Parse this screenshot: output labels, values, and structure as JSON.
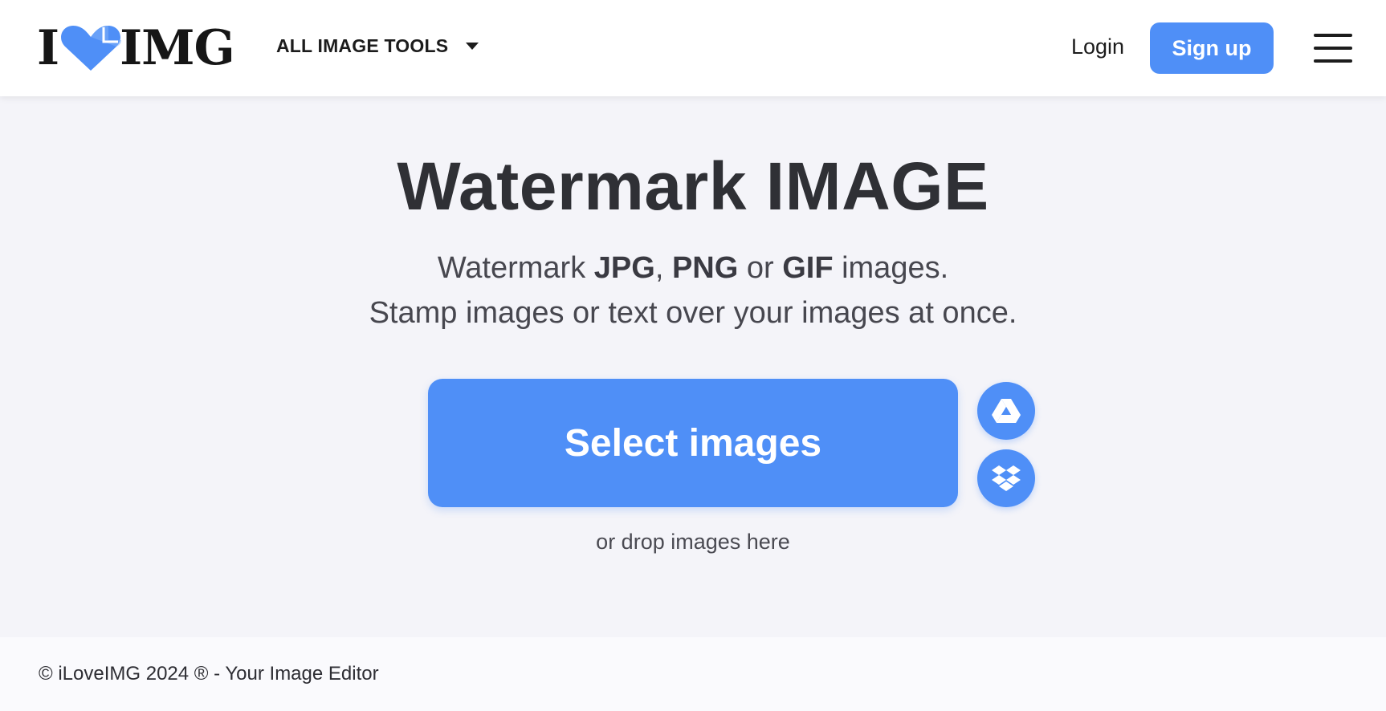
{
  "header": {
    "logo": {
      "text_left": "I",
      "text_right": "IMG",
      "icon": "heart-icon",
      "brand_color": "#4f8ff7"
    },
    "tools_menu_label": "ALL IMAGE TOOLS",
    "login_label": "Login",
    "signup_label": "Sign up",
    "menu_icon": "hamburger-menu-icon"
  },
  "main": {
    "title": "Watermark IMAGE",
    "subtitle": {
      "line1_prefix": "Watermark ",
      "fmt1": "JPG",
      "sep1": ", ",
      "fmt2": "PNG",
      "sep2": " or ",
      "fmt3": "GIF",
      "line1_suffix": " images.",
      "line2": "Stamp images or text over your images at once."
    },
    "select_button_label": "Select images",
    "cloud_buttons": [
      {
        "name": "Google Drive",
        "icon": "google-drive-icon"
      },
      {
        "name": "Dropbox",
        "icon": "dropbox-icon"
      }
    ],
    "drop_hint": "or drop images here"
  },
  "footer": {
    "copyright": "© iLoveIMG 2024 ® - Your Image Editor"
  },
  "colors": {
    "accent": "#4f8ff7",
    "background": "#f4f4f9",
    "header_bg": "#ffffff",
    "text_dark": "#2f3035"
  }
}
